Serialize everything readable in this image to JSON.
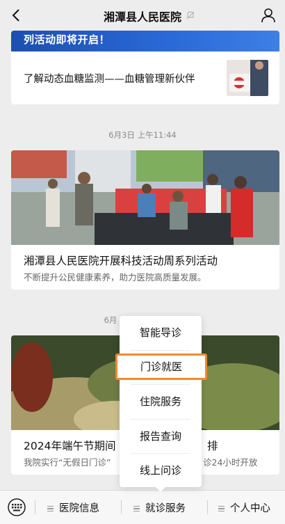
{
  "header": {
    "title": "湘潭县人民医院"
  },
  "card1": {
    "banner_text": "列活动即将开启！",
    "article_title": "了解动态血糖监测——血糖管理新伙伴"
  },
  "time1": "6月3日 上午11:44",
  "card2": {
    "title": "湘潭县人民医院开展科技活动周系列活动",
    "subtitle": "不断提升公民健康素养，助力医院高质量发展。"
  },
  "time2": "6月",
  "card3": {
    "title_left": "2024年端午节期间",
    "title_right": "排",
    "subtitle_left": "我院实行“无假日门诊”",
    "subtitle_right": "诊24小时开放"
  },
  "popup": {
    "items": [
      "智能导诊",
      "门诊就医",
      "住院服务",
      "报告查询",
      "线上问诊"
    ],
    "highlighted_index": 1
  },
  "menubar": {
    "items": [
      "医院信息",
      "就诊服务",
      "个人中心"
    ]
  },
  "colors": {
    "highlight": "#f08a2e",
    "banner": "#2a6ad8"
  }
}
